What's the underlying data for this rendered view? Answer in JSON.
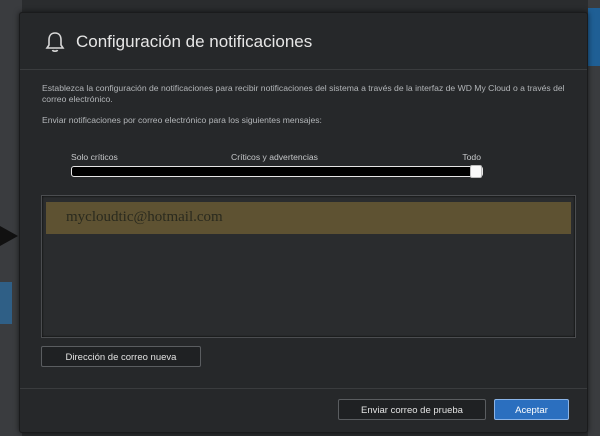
{
  "dialog": {
    "title": "Configuración de notificaciones",
    "description": "Establezca la configuración de notificaciones para recibir notificaciones del sistema a través de la interfaz de WD My Cloud o a través del correo electrónico.",
    "send_label": "Enviar notificaciones por correo electrónico para los siguientes mensajes:"
  },
  "slider": {
    "labels": [
      "Solo críticos",
      "Críticos y advertencias",
      "Todo"
    ],
    "selected": "Todo",
    "level": 1.0
  },
  "emails": [
    "mycloudtic@hotmail.com"
  ],
  "buttons": {
    "new_email": "Dirección de correo nueva",
    "test_email": "Enviar correo de prueba",
    "accept": "Aceptar"
  },
  "colors": {
    "accent": "#2b6fbf",
    "email_row": "#5e5232"
  },
  "icons": {
    "title": "bell-icon"
  }
}
